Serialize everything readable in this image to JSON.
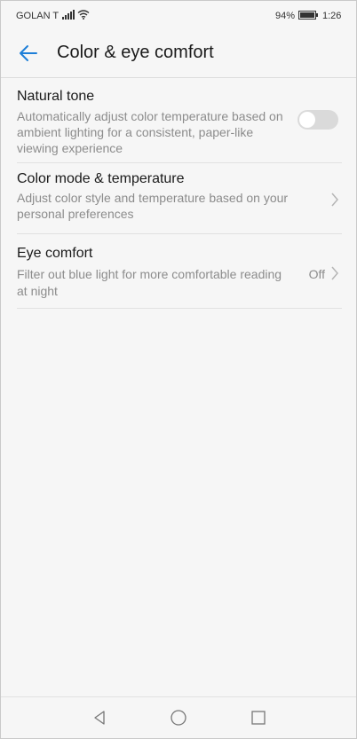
{
  "status_bar": {
    "carrier": "GOLAN T",
    "battery_percent": "94%",
    "time": "1:26"
  },
  "header": {
    "title": "Color & eye comfort",
    "back_icon": "arrow-left-icon"
  },
  "settings": {
    "natural_tone": {
      "title": "Natural tone",
      "description": "Automatically adjust color temperature based on ambient lighting for a consistent, paper-like viewing experience",
      "enabled": false
    },
    "color_mode": {
      "title": "Color mode & temperature",
      "description": "Adjust color style and temperature based on your personal preferences"
    },
    "eye_comfort": {
      "title": "Eye comfort",
      "description": "Filter out blue light for more comfortable reading at night",
      "value": "Off"
    }
  },
  "nav_bar": {
    "icons": [
      "triangle-back-icon",
      "circle-home-icon",
      "square-recents-icon"
    ]
  },
  "colors": {
    "accent": "#1e7fd8",
    "background": "#f6f6f6",
    "toggle_off": "#dadada"
  }
}
